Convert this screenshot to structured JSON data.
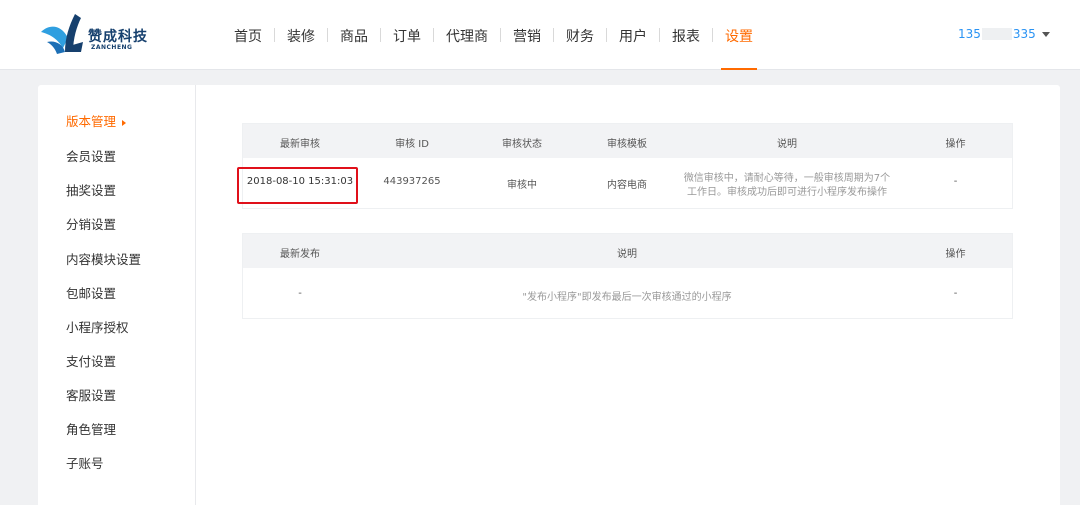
{
  "header": {
    "logo": {
      "name_cn": "赞成科技",
      "name_en": "ZANCHENG"
    },
    "nav": [
      {
        "label": "首页",
        "active": false
      },
      {
        "label": "装修",
        "active": false
      },
      {
        "label": "商品",
        "active": false
      },
      {
        "label": "订单",
        "active": false
      },
      {
        "label": "代理商",
        "active": false
      },
      {
        "label": "营销",
        "active": false
      },
      {
        "label": "财务",
        "active": false
      },
      {
        "label": "用户",
        "active": false
      },
      {
        "label": "报表",
        "active": false
      },
      {
        "label": "设置",
        "active": true
      }
    ],
    "user": {
      "prefix": "135",
      "suffix": "335",
      "icon": "caret-down-icon"
    }
  },
  "sidebar": {
    "items": [
      {
        "label": "版本管理",
        "active": true
      },
      {
        "label": "会员设置",
        "active": false
      },
      {
        "label": "抽奖设置",
        "active": false
      },
      {
        "label": "分销设置",
        "active": false
      },
      {
        "label": "内容模块设置",
        "active": false
      },
      {
        "label": "包邮设置",
        "active": false
      },
      {
        "label": "小程序授权",
        "active": false
      },
      {
        "label": "支付设置",
        "active": false
      },
      {
        "label": "客服设置",
        "active": false
      },
      {
        "label": "角色管理",
        "active": false
      },
      {
        "label": "子账号",
        "active": false
      }
    ]
  },
  "review_table": {
    "headers": [
      "最新审核",
      "审核 ID",
      "审核状态",
      "审核模板",
      "说明",
      "操作"
    ],
    "row": {
      "date": "2018-08-10 15:31:03",
      "id": "443937265",
      "status": "审核中",
      "template": "内容电商",
      "note_line1": "微信审核中，请耐心等待，一般审核周期为7个",
      "note_line2": "工作日。审核成功后即可进行小程序发布操作",
      "action": "-"
    }
  },
  "publish_table": {
    "headers": [
      "最新发布",
      "说明",
      "操作"
    ],
    "row": {
      "latest": "-",
      "note": "\"发布小程序\"即发布最后一次审核通过的小程序",
      "action": "-"
    }
  },
  "colors": {
    "accent": "#ff6a00",
    "highlight_box": "#e0101a",
    "user_link": "#2a93f3"
  }
}
